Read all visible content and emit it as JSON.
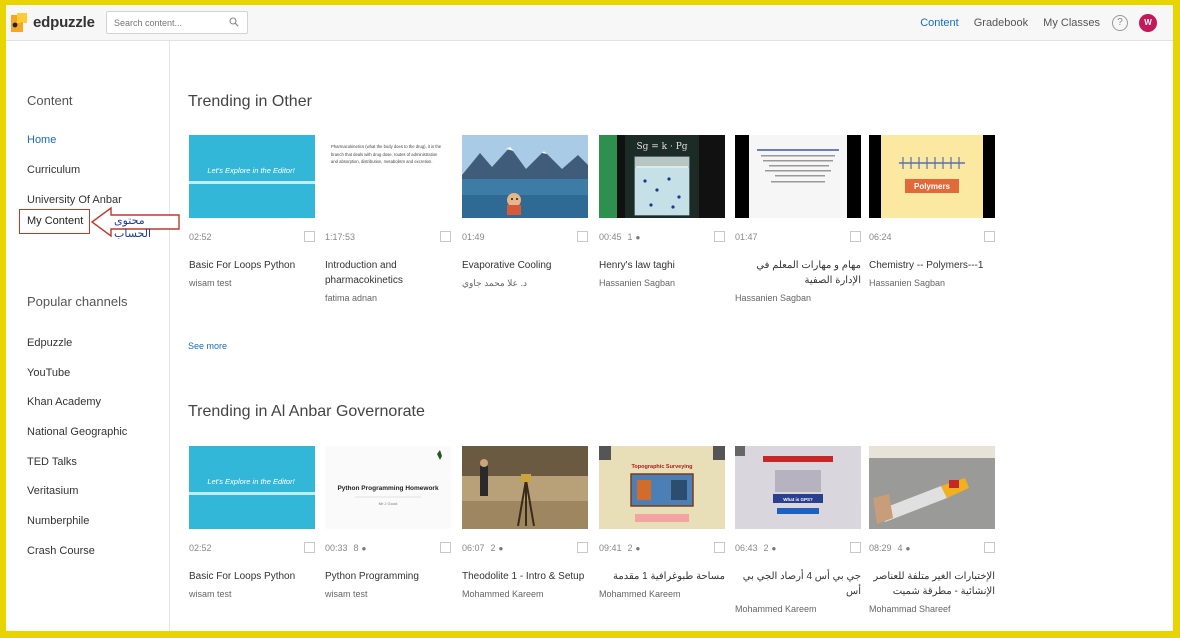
{
  "app": {
    "logo_text": "edpuzzle"
  },
  "search": {
    "placeholder": "Search content..."
  },
  "topnav": {
    "items": [
      {
        "label": "Content",
        "active": true
      },
      {
        "label": "Gradebook"
      },
      {
        "label": "My Classes"
      }
    ],
    "help": "?",
    "avatar": "W"
  },
  "sidebar": {
    "content_heading": "Content",
    "content_items": [
      "Home",
      "Curriculum",
      "University Of Anbar",
      "My Content"
    ],
    "channels_heading": "Popular channels",
    "channels": [
      "Edpuzzle",
      "YouTube",
      "Khan Academy",
      "National Geographic",
      "TED Talks",
      "Veritasium",
      "Numberphile",
      "Crash Course"
    ]
  },
  "annotation": {
    "text": "محتوى الحساب"
  },
  "sections": [
    {
      "title": "Trending in Other",
      "see_more": "See more",
      "cards": [
        {
          "duration": "02:52",
          "questions": "",
          "title": "Basic For Loops Python",
          "author": "wisam test",
          "thumb_text": "Let's Explore in the Editor!"
        },
        {
          "duration": "1:17:53",
          "questions": "",
          "title": "Introduction and pharmacokinetics",
          "author": "fatima adnan",
          "thumb_text": "Pharmacokinetics (what the body does to the drug), it is the branch that deals with drug dose, routes of administration and absorption, distribution, metabolism and excretion."
        },
        {
          "duration": "01:49",
          "questions": "",
          "title": "Evaporative Cooling",
          "author": "د. علا محمد جاوي",
          "thumb_text": ""
        },
        {
          "duration": "00:45",
          "questions": "1",
          "title": "Henry's law taghi",
          "author": "Hassanien Sagban",
          "thumb_text": "Sg = k · Pg"
        },
        {
          "duration": "01:47",
          "questions": "",
          "title": "مهام و مهارات المعلم في الإدارة الصفية",
          "author": "Hassanien Sagban",
          "thumb_text": ""
        },
        {
          "duration": "06:24",
          "questions": "",
          "title": "Chemistry -- Polymers---1",
          "author": "Hassanien Sagban",
          "thumb_text": "Polymers"
        }
      ]
    },
    {
      "title": "Trending in Al Anbar Governorate",
      "cards": [
        {
          "duration": "02:52",
          "questions": "",
          "title": "Basic For Loops Python",
          "author": "wisam test",
          "thumb_text": "Let's Explore in the Editor!"
        },
        {
          "duration": "00:33",
          "questions": "8",
          "title": "Python Programming",
          "author": "wisam test",
          "thumb_text": "Python Programming Homework",
          "thumb_sub": "Mr J Good"
        },
        {
          "duration": "06:07",
          "questions": "2",
          "title": "Theodolite 1 - Intro & Setup",
          "author": "Mohammed Kareem",
          "thumb_text": ""
        },
        {
          "duration": "09:41",
          "questions": "2",
          "title": "مساحة طبوغرافية 1 مقدمة",
          "author": "Mohammed Kareem",
          "thumb_text": "Topographic Surveying"
        },
        {
          "duration": "06:43",
          "questions": "2",
          "title": "جي بي أس 4 أرصاد الجي بي أس",
          "author": "Mohammed Kareem",
          "thumb_text": "What is GPS?"
        },
        {
          "duration": "08:29",
          "questions": "4",
          "title": "الإختبارات الغير متلفة للعناصر الإنشائية - مطرقة شميت",
          "author": "Mohammad Shareef",
          "thumb_text": ""
        }
      ]
    }
  ]
}
